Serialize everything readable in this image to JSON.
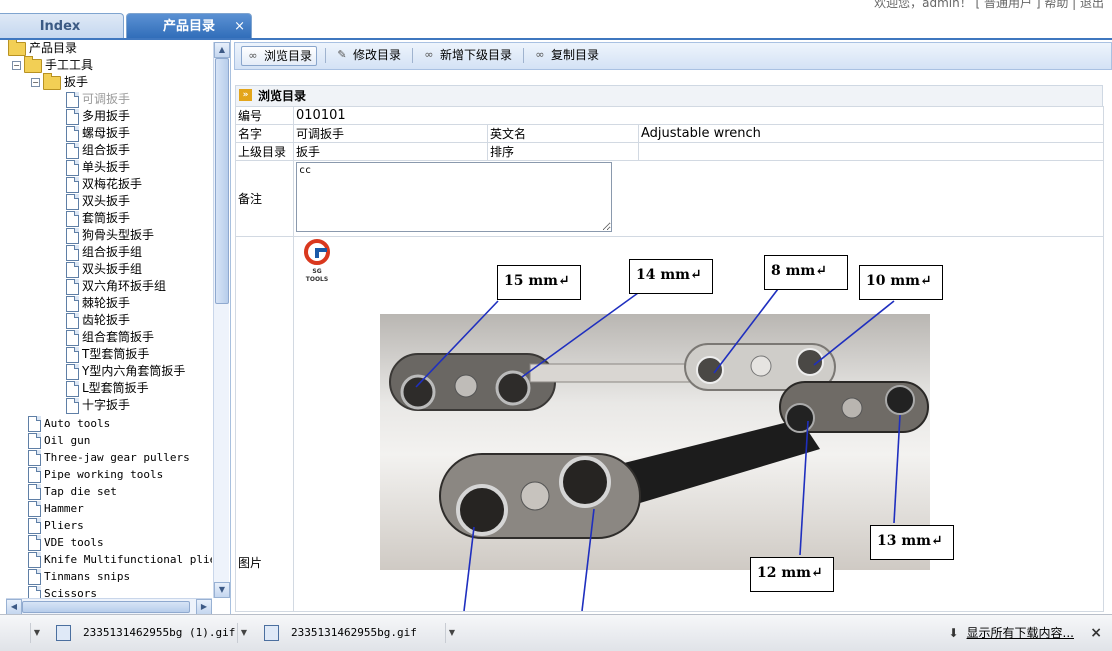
{
  "header": {
    "user_info": "欢迎您，admin！ [ 普通用户 ]  帮助 | 退出",
    "tabs": [
      {
        "label": "Index"
      },
      {
        "label": "产品目录",
        "close": "×"
      }
    ]
  },
  "tree": {
    "root": "产品目录",
    "level1": "手工工具",
    "level2": "扳手",
    "wrench_items": [
      "可调扳手",
      "多用扳手",
      "螺母扳手",
      "组合扳手",
      "单头扳手",
      "双梅花扳手",
      "双头扳手",
      "套筒扳手",
      "狗骨头型扳手",
      "组合扳手组",
      "双头扳手组",
      "双六角环扳手组",
      "棘轮扳手",
      "齿轮扳手",
      "组合套筒扳手",
      "T型套筒扳手",
      "Y型内六角套筒扳手",
      "L型套筒扳手",
      "十字扳手"
    ],
    "other_items": [
      "Auto tools",
      "Oil gun",
      "Three-jaw gear pullers",
      "Pipe working tools",
      "Tap die set",
      "Hammer",
      "Pliers",
      "VDE tools",
      "Knife Multifunctional plier",
      "Tinmans snips",
      "Scissors"
    ]
  },
  "toolbar": {
    "browse": "浏览目录",
    "edit": "修改目录",
    "add_child": "新增下级目录",
    "copy": "复制目录"
  },
  "section": {
    "title": "浏览目录"
  },
  "form": {
    "code_label": "编号",
    "code_value": "010101",
    "name_label": "名字",
    "name_value": "可调扳手",
    "en_label": "英文名",
    "en_value": "Adjustable wrench",
    "parent_label": "上级目录",
    "parent_value": "扳手",
    "sort_label": "排序",
    "sort_value": "",
    "memo_label": "备注",
    "memo_value": "cc",
    "image_label": "图片"
  },
  "image": {
    "logo_text": "SG TOOLS",
    "callouts": [
      "15 mm↵",
      "14 mm↵",
      "8 mm↵",
      "10 mm↵",
      "13 mm↵",
      "12 mm↵"
    ]
  },
  "downloads": {
    "items": [
      "2335131462955bg (1).gif",
      "2335131462955bg.gif"
    ],
    "show_all": "显示所有下载内容...",
    "close": "×"
  }
}
